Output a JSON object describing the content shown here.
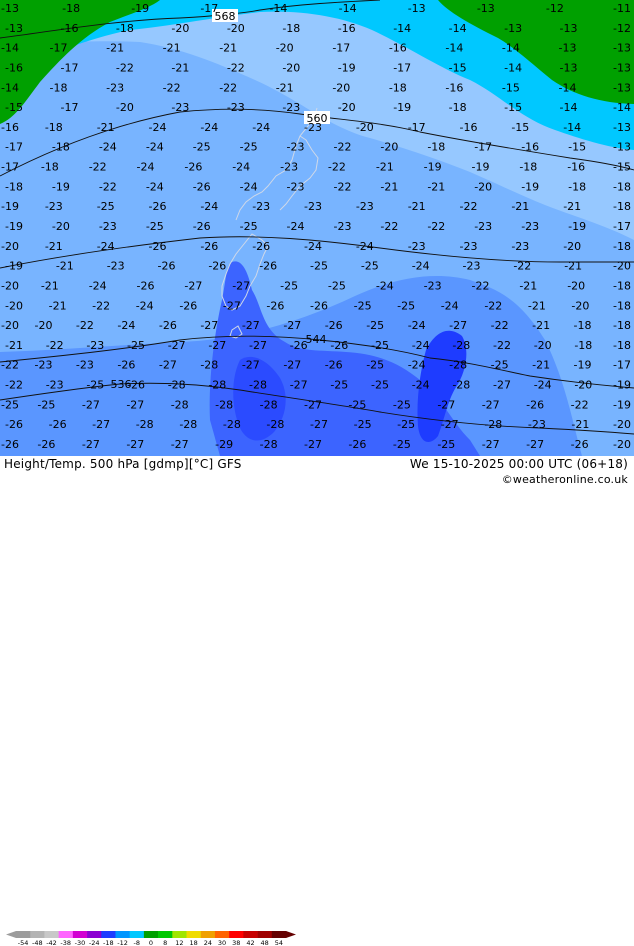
{
  "header": {
    "title": "Height/Temp. 500 hPa [gdmp][°C] GFS",
    "valid_time": "We 15-10-2025 00:00 UTC (06+18)",
    "credit": "©weatheronline.co.uk"
  },
  "legend": {
    "ticks": [
      "-54",
      "-48",
      "-42",
      "-38",
      "-30",
      "-24",
      "-18",
      "-12",
      "-8",
      "0",
      "8",
      "12",
      "18",
      "24",
      "30",
      "38",
      "42",
      "48",
      "54"
    ],
    "colors": [
      "#9c9c9c",
      "#b4b4b4",
      "#c8c8c8",
      "#ff64ff",
      "#d200d2",
      "#8c00d2",
      "#1e3cff",
      "#0096ff",
      "#00c8ff",
      "#00a000",
      "#00c800",
      "#a0e600",
      "#f0dc00",
      "#f0a000",
      "#ff6400",
      "#ff0000",
      "#c80000",
      "#a00000",
      "#640000"
    ]
  },
  "chart_data": {
    "type": "heatmap",
    "field": "500 hPa temperature (°C) with geopotential height contours (gdmp)",
    "height_contours": [
      {
        "label": "568",
        "value": 568
      },
      {
        "label": "560",
        "value": 560
      },
      {
        "label": "544",
        "value": 544
      },
      {
        "label": "536",
        "value": 536
      }
    ],
    "temperature_labels": [
      [
        -13,
        -18,
        -19,
        -17,
        -14,
        -14,
        -13,
        -13,
        -12,
        -11
      ],
      [
        -13,
        -16,
        -18,
        -20,
        -20,
        -18,
        -16,
        -14,
        -14,
        -13,
        -13,
        -12
      ],
      [
        -14,
        -17,
        -21,
        -21,
        -21,
        -20,
        -17,
        -16,
        -14,
        -14,
        -13,
        -13
      ],
      [
        -16,
        -17,
        -22,
        -21,
        -22,
        -20,
        -19,
        -17,
        -15,
        -14,
        -13,
        -13
      ],
      [
        -14,
        -18,
        -23,
        -22,
        -22,
        -21,
        -20,
        -18,
        -16,
        -15,
        -14,
        -13
      ],
      [
        -15,
        -17,
        -20,
        -23,
        -23,
        -23,
        -20,
        -19,
        -18,
        -15,
        -14,
        -14
      ],
      [
        -16,
        -18,
        -21,
        -24,
        -24,
        -24,
        -23,
        -20,
        -17,
        -16,
        -15,
        -14,
        -13
      ],
      [
        -17,
        -18,
        -24,
        -24,
        -25,
        -25,
        -23,
        -22,
        -20,
        -18,
        -17,
        -16,
        -15,
        -13
      ],
      [
        -17,
        -18,
        -22,
        -24,
        -26,
        -24,
        -23,
        -22,
        -21,
        -19,
        -19,
        -18,
        -16,
        -15
      ],
      [
        -18,
        -19,
        -22,
        -24,
        -26,
        -24,
        -23,
        -22,
        -21,
        -21,
        -20,
        -19,
        -18,
        -18
      ],
      [
        -19,
        -23,
        -25,
        -26,
        -24,
        -23,
        -23,
        -23,
        -21,
        -22,
        -21,
        -21,
        -18
      ],
      [
        -19,
        -20,
        -23,
        -25,
        -26,
        -25,
        -24,
        -23,
        -22,
        -22,
        -23,
        -23,
        -19,
        -17
      ],
      [
        -20,
        -21,
        -24,
        -26,
        -26,
        -26,
        -24,
        -24,
        -23,
        -23,
        -23,
        -20,
        -18
      ],
      [
        -19,
        -21,
        -23,
        -26,
        -26,
        -26,
        -25,
        -25,
        -24,
        -23,
        -22,
        -21,
        -20
      ],
      [
        -20,
        -21,
        -24,
        -26,
        -27,
        -27,
        -25,
        -25,
        -24,
        -23,
        -22,
        -21,
        -20,
        -18
      ],
      [
        -20,
        -21,
        -22,
        -24,
        -26,
        -27,
        -26,
        -26,
        -25,
        -25,
        -24,
        -22,
        -21,
        -20,
        -18
      ],
      [
        -20,
        -20,
        -22,
        -24,
        -26,
        -27,
        -27,
        -27,
        -26,
        -25,
        -24,
        -27,
        -22,
        -21,
        -18,
        -18
      ],
      [
        -21,
        -22,
        -23,
        -25,
        -27,
        -27,
        -27,
        -26,
        -26,
        -25,
        -24,
        -28,
        -22,
        -20,
        -18,
        -18
      ],
      [
        -22,
        -23,
        -23,
        -26,
        -27,
        -28,
        -27,
        -27,
        -26,
        -25,
        -24,
        -28,
        -25,
        -21,
        -19,
        -17
      ],
      [
        -22,
        -23,
        -25,
        -26,
        -28,
        -28,
        -28,
        -27,
        -25,
        -25,
        -24,
        -28,
        -27,
        -24,
        -20,
        -19
      ],
      [
        -25,
        -25,
        -27,
        -27,
        -28,
        -28,
        -28,
        -27,
        -25,
        -25,
        -27,
        -27,
        -26,
        -22,
        -19
      ],
      [
        -26,
        -26,
        -27,
        -28,
        -28,
        -28,
        -28,
        -27,
        -25,
        -25,
        -27,
        -28,
        -23,
        -21,
        -20
      ],
      [
        -26,
        -26,
        -27,
        -27,
        -27,
        -29,
        -28,
        -27,
        -26,
        -25,
        -25,
        -27,
        -27,
        -26,
        -20
      ]
    ]
  }
}
